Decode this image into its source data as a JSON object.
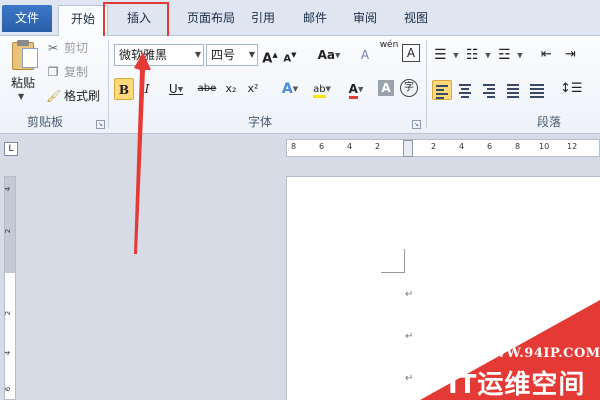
{
  "tabs": {
    "file": "文件",
    "home": "开始",
    "insert": "插入",
    "page_layout": "页面布局",
    "references": "引用",
    "mailings": "邮件",
    "review": "审阅",
    "view": "视图"
  },
  "clipboard": {
    "paste": "粘贴",
    "cut": "剪切",
    "copy": "复制",
    "format_painter": "格式刷",
    "group_label": "剪贴板"
  },
  "font": {
    "font_name": "微软雅黑",
    "font_size": "四号",
    "group_label": "字体",
    "grow": "A",
    "shrink": "A",
    "change_case": "Aa",
    "clear_format": "A",
    "phonetic": "wén",
    "border_char": "A",
    "bold": "B",
    "italic": "I",
    "underline": "U",
    "strike": "abe",
    "subscript": "x₂",
    "superscript": "x²",
    "text_effect": "A",
    "highlight": "ab",
    "font_color": "A",
    "char_shading": "A",
    "enclose": "字"
  },
  "paragraph": {
    "group_label": "段落"
  },
  "ruler": {
    "numbers": [
      "8",
      "6",
      "4",
      "2",
      "2",
      "4",
      "6",
      "8",
      "10",
      "12"
    ],
    "vnumbers": [
      "4",
      "2",
      "2",
      "4",
      "6"
    ]
  },
  "tab_selector": "L",
  "paragraph_mark": "↵",
  "watermark": {
    "url": "WWW.94IP.COM",
    "brand": "IT运维空间"
  },
  "colors": {
    "accent_red": "#e53935",
    "file_tab": "#2f66b3",
    "active_highlight": "#ffd97a"
  }
}
